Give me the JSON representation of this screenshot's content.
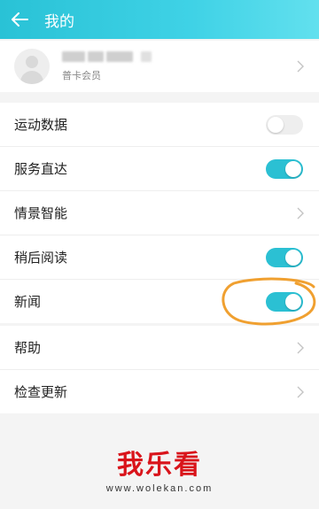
{
  "header": {
    "title": "我的",
    "back_icon": "arrow-left-icon"
  },
  "profile": {
    "level": "普卡会员"
  },
  "settings": [
    {
      "label": "运动数据",
      "type": "toggle",
      "on": false
    },
    {
      "label": "服务直达",
      "type": "toggle",
      "on": true
    },
    {
      "label": "情景智能",
      "type": "link"
    },
    {
      "label": "稍后阅读",
      "type": "toggle",
      "on": true
    },
    {
      "label": "新闻",
      "type": "toggle",
      "on": true
    }
  ],
  "other": [
    {
      "label": "帮助",
      "type": "link"
    },
    {
      "label": "检查更新",
      "type": "link"
    }
  ],
  "watermark": {
    "title": "我乐看",
    "url": "www.wolekan.com"
  },
  "colors": {
    "accent": "#2bc0d3",
    "annotation": "#f0a030",
    "watermark": "#d9141b"
  }
}
